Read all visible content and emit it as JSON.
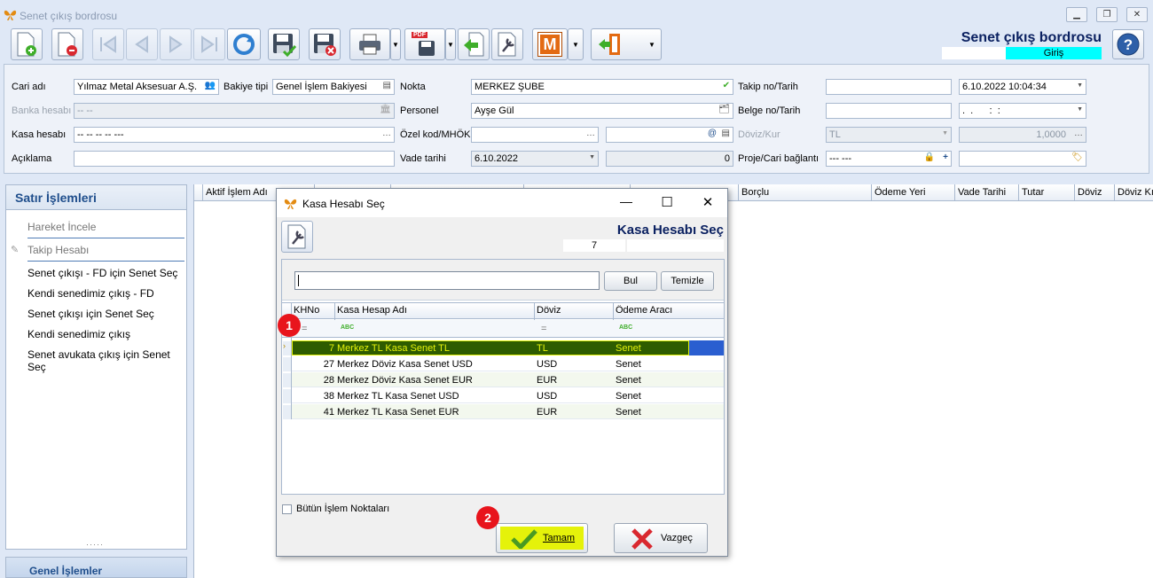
{
  "window": {
    "title": "Senet çıkış bordrosu"
  },
  "header": {
    "title": "Senet çıkış bordrosu",
    "mode": "Giriş"
  },
  "toolbar": {
    "m_label": "M",
    "pdf_label": "PDF"
  },
  "form": {
    "cari_adi": {
      "label": "Cari adı",
      "value": "Yılmaz Metal Aksesuar A.Ş."
    },
    "bakiye_tipi": {
      "label": "Bakiye tipi",
      "value": "Genel İşlem Bakiyesi"
    },
    "nokta": {
      "label": "Nokta",
      "value": "MERKEZ ŞUBE"
    },
    "takip_no": {
      "label": "Takip no/Tarih",
      "value": "",
      "date": "6.10.2022 10:04:34"
    },
    "banka_hesabi": {
      "label": "Banka hesabı",
      "value": "-- --"
    },
    "personel": {
      "label": "Personel",
      "value": "Ayşe Gül"
    },
    "belge_no": {
      "label": "Belge no/Tarih",
      "value": "",
      "date": ".  .      :  :"
    },
    "kasa_hesabi": {
      "label": "Kasa hesabı",
      "value": "-- -- -- -- ---"
    },
    "ozel_kod": {
      "label": "Özel kod/MHÖK",
      "value": "",
      "value2": ""
    },
    "doviz_kur": {
      "label": "Döviz/Kur",
      "value": "TL",
      "rate": "1,0000"
    },
    "aciklama": {
      "label": "Açıklama",
      "value": ""
    },
    "vade_tarihi": {
      "label": "Vade tarihi",
      "value": "6.10.2022",
      "days": "0"
    },
    "proje": {
      "label": "Proje/Cari bağlantı",
      "value": "--- ---",
      "value2": ""
    }
  },
  "left_panel": {
    "title": "Satır İşlemleri",
    "items": [
      {
        "label": "Hareket İncele"
      },
      {
        "label": "Takip Hesabı"
      },
      {
        "label": "Senet çıkışı - FD için Senet Seç"
      },
      {
        "label": "Kendi senedimiz çıkış - FD"
      },
      {
        "label": "Senet çıkışı için Senet Seç"
      },
      {
        "label": "Kendi senedimiz çıkış"
      },
      {
        "label": "Senet avukata çıkış için Senet Seç"
      }
    ],
    "grip": "·····",
    "footer": "Genel İşlemler"
  },
  "main_grid": {
    "columns": [
      "Aktif İşlem Adı",
      "Borçlu",
      "Ödeme Yeri",
      "Vade Tarihi",
      "Tutar",
      "Döviz",
      "Döviz Kı"
    ]
  },
  "dialog": {
    "title": "Kasa Hesabı Seç",
    "header": "Kasa Hesabı Seç",
    "selected_value": "7",
    "search_value": "",
    "find_button": "Bul",
    "clear_button": "Temizle",
    "columns": [
      "KHNo",
      "Kasa Hesap Adı",
      "Döviz",
      "Ödeme Aracı"
    ],
    "filter_ops": [
      "=",
      "ABC",
      "=",
      "ABC"
    ],
    "rows": [
      {
        "no": "7",
        "name": "Merkez TL Kasa Senet TL",
        "currency": "TL",
        "method": "Senet"
      },
      {
        "no": "27",
        "name": "Merkez Döviz Kasa Senet USD",
        "currency": "USD",
        "method": "Senet"
      },
      {
        "no": "28",
        "name": "Merkez Döviz Kasa Senet EUR",
        "currency": "EUR",
        "method": "Senet"
      },
      {
        "no": "38",
        "name": "Merkez TL Kasa Senet USD",
        "currency": "USD",
        "method": "Senet"
      },
      {
        "no": "41",
        "name": "Merkez TL Kasa Senet EUR",
        "currency": "EUR",
        "method": "Senet"
      }
    ],
    "all_points_label": "Bütün İşlem Noktaları",
    "ok_button": "Tamam",
    "cancel_button": "Vazgeç"
  },
  "callouts": {
    "one": "1",
    "two": "2"
  },
  "colors": {
    "accent": "#1f4e8c",
    "highlight": "#e5f20a",
    "selected_row": "#2e5c00",
    "callout": "#e8141c",
    "mode_badge": "#00ffff"
  }
}
